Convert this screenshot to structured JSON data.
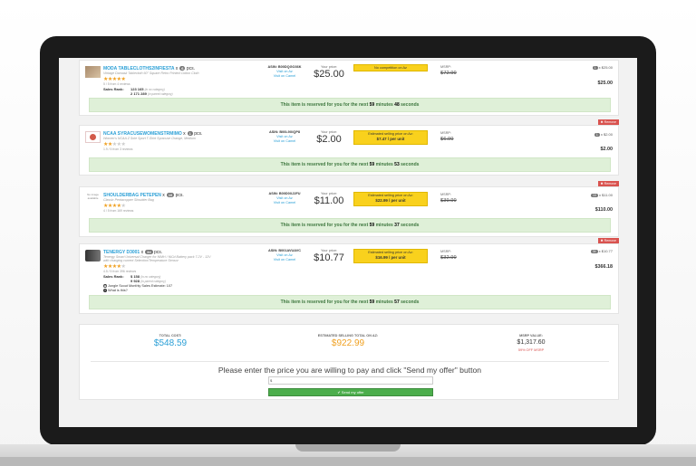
{
  "items": [
    {
      "title": "MODA TABLECLOTHS2INFIESTA",
      "qty": "6",
      "pcs": "pcs.",
      "subtitle": "Vintage Damask Tablecloth 60\" Square Retro Printed Cotton Cloth",
      "stars_full": "★★★★★",
      "stars_empty": "",
      "reviews": "5 / 5 from 4 reviews",
      "salesrank_label": "Sales Rank:",
      "salesrank_1": "123 165",
      "salesrank_1_note": "(in no category)",
      "salesrank_2": "2 171 289",
      "salesrank_2_note": "(in parent category)",
      "asin": "ASIN: B00DQGO36K",
      "asin_link_1": "Visit on Az",
      "asin_link_2": "Visit on Camel",
      "price_label": "Your price:",
      "price": "$25.00",
      "est_line": "No competition on Az",
      "est_unit": "",
      "msrp_label": "MSRP:",
      "msrp": "$72.99",
      "x_qty": "1",
      "x_price": "x $25.00",
      "total": "$25.00",
      "remove": "",
      "reserved_pre": "This item is reserved for you for the next ",
      "minutes": "59",
      "minutes_word": " minutes ",
      "seconds": "48",
      "seconds_word": " seconds"
    },
    {
      "title": "NCAA SYRACUSEWOMENSTRMIMO",
      "qty": "1",
      "pcs": "pcs.",
      "subtitle": "Women's NCAA Z Sole Sport T-Shirt Syracuse Orange, Medium",
      "stars_full": "★★",
      "stars_empty": "★★★",
      "reviews": "1.9 / 5 from 3 reviews",
      "asin": "ASIN: B00L9XIQP8",
      "asin_link_1": "Visit on Az",
      "asin_link_2": "Visit on Camel",
      "price_label": "Your price:",
      "price": "$2.00",
      "est_line": "Estimated selling price on Az:",
      "est_unit": "$7.47 / per unit",
      "msrp_label": "MSRP:",
      "msrp": "$6.99",
      "x_qty": "1",
      "x_price": "x $2.00",
      "total": "$2.00",
      "remove": "✖ Remove",
      "reserved_pre": "This item is reserved for you for the next ",
      "minutes": "59",
      "minutes_word": " minutes ",
      "seconds": "53",
      "seconds_word": " seconds"
    },
    {
      "title": "SHOULDERBAG PETEPEN",
      "qty": "10",
      "pcs": "pcs.",
      "subtitle": "Classic Pentacopper Shoulder Bag",
      "stars_full": "★★★★",
      "stars_empty": "★",
      "reviews": "4 / 5 from 169 reviews",
      "asin": "ASIN: B00D0XJ2FU",
      "asin_link_1": "Visit on Az",
      "asin_link_2": "Visit on Camel",
      "price_label": "Your price:",
      "price": "$11.00",
      "est_line": "Estimated selling price on Az:",
      "est_unit": "$22.99 / per unit",
      "msrp_label": "MSRP:",
      "msrp": "$39.99",
      "x_qty": "10",
      "x_price": "x $11.00",
      "total": "$110.00",
      "remove": "✖ Remove",
      "thumb_text": "No image available",
      "reserved_pre": "This item is reserved for you for the next ",
      "minutes": "59",
      "minutes_word": " minutes ",
      "seconds": "37",
      "seconds_word": " seconds"
    },
    {
      "title": "TENERGY D3001",
      "qty": "34",
      "pcs": "pcs.",
      "subtitle": "Tenergy Smart Universal Charger for NiMH / NiCd Battery pack 7.2V - 12V",
      "subtitle_2": "with charging current Selection/Temperature Sensor",
      "stars_full": "★★★★",
      "stars_empty": "★",
      "reviews": "4.5 / 5 from 396 reviews",
      "salesrank_label": "Sales Rank:",
      "salesrank_1": "$ 158",
      "salesrank_1_note": "(in no category)",
      "salesrank_2": "9 928",
      "salesrank_2_note": "(in parent category)",
      "jungle": "Jungle Scout Monthly Sales Estimate: 107",
      "whatis": "What is this?",
      "asin": "ASIN: B001AVUAVC",
      "asin_link_1": "Visit on Az",
      "asin_link_2": "Visit on Camel",
      "price_label": "Your price:",
      "price": "$10.77",
      "est_line": "Estimated selling price on Az:",
      "est_unit": "$16.99 / per unit",
      "msrp_label": "MSRP:",
      "msrp": "$32.99",
      "x_qty": "34",
      "x_price": "x $10.77",
      "total": "$366.18",
      "remove": "✖ Remove",
      "reserved_pre": "This item is reserved for you for the next ",
      "minutes": "59",
      "minutes_word": " minutes ",
      "seconds": "57",
      "seconds_word": " seconds"
    }
  ],
  "totals": {
    "cost_label": "TOTAL COST:",
    "cost": "$548.59",
    "est_label": "ESTIMATED SELLING TOTAL ON AZ:",
    "est": "$922.99",
    "msrp_label": "MSRP VALUE:",
    "msrp": "$1,317.60",
    "off": "59% OFF MSRP"
  },
  "offer": {
    "prompt": "Please enter the price you are willing to pay and click \"Send my offer\" button",
    "currency": "$",
    "input_value": "",
    "button": "✔ Send my offer"
  },
  "colors": {
    "accent": "#2a9fd6",
    "estimate_box": "#f9d11d",
    "reserved_bg": "#dff0d8",
    "remove": "#d9534f",
    "send_button": "#4cae4c"
  }
}
